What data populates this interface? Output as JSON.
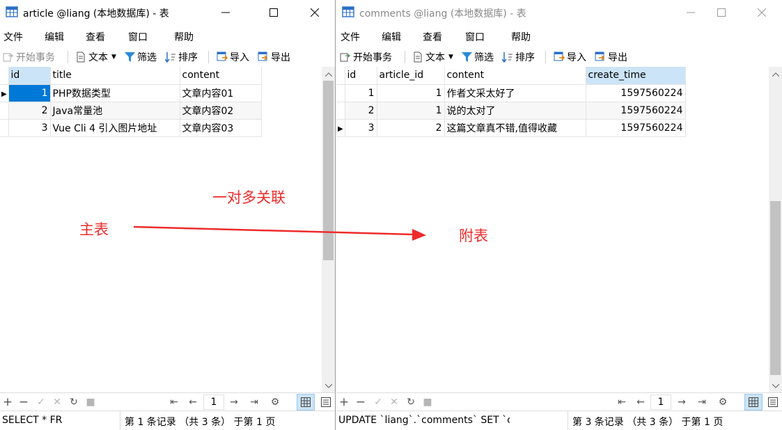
{
  "left": {
    "title": "article @liang (本地数据库) - 表",
    "menu": [
      "文件",
      "编辑",
      "查看",
      "窗口",
      "帮助"
    ],
    "toolbar": {
      "begin_tx": "开始事务",
      "text": "文本",
      "filter": "筛选",
      "sort": "排序",
      "import": "导入",
      "export": "导出"
    },
    "columns": [
      "id",
      "title",
      "content"
    ],
    "rows": [
      [
        "1",
        "PHP数据类型",
        "文章内容01"
      ],
      [
        "2",
        "Java常量池",
        "文章内容02"
      ],
      [
        "3",
        "Vue Cli 4 引入图片地址",
        "文章内容03"
      ]
    ],
    "page": "1",
    "status_sql": "SELECT * FR",
    "status_info": "第 1 条记录 （共 3 条） 于第 1 页"
  },
  "right": {
    "title": "comments @liang (本地数据库) - 表",
    "menu": [
      "文件",
      "编辑",
      "查看",
      "窗口",
      "帮助"
    ],
    "toolbar": {
      "begin_tx": "开始事务",
      "text": "文本",
      "filter": "筛选",
      "sort": "排序",
      "import": "导入",
      "export": "导出"
    },
    "columns": [
      "id",
      "article_id",
      "content",
      "create_time"
    ],
    "rows": [
      [
        "1",
        "1",
        "作者文采太好了",
        "1597560224"
      ],
      [
        "2",
        "1",
        "说的太对了",
        "1597560224"
      ],
      [
        "3",
        "2",
        "这篇文章真不错,值得收藏",
        "1597560224"
      ]
    ],
    "page": "1",
    "status_sql": "UPDATE `liang`.`comments` SET `c",
    "status_info": "第 3 条记录 （共 3 条） 于第 1 页"
  },
  "annotations": {
    "relation": "一对多关联",
    "main_table": "主表",
    "sub_table": "附表"
  },
  "colors": {
    "annotation": "#ee2b2b",
    "selection": "#0078d7",
    "header_selected": "#cce4f7"
  },
  "icons": [
    "table-icon",
    "minimize-icon",
    "maximize-icon",
    "close-icon",
    "begin-transaction-icon",
    "text-icon",
    "filter-icon",
    "sort-icon",
    "import-icon",
    "export-icon",
    "add-record-icon",
    "delete-record-icon",
    "apply-icon",
    "discard-icon",
    "refresh-icon",
    "stop-icon",
    "first-page-icon",
    "prev-page-icon",
    "next-page-icon",
    "last-page-icon",
    "settings-icon",
    "grid-view-icon",
    "form-view-icon"
  ]
}
